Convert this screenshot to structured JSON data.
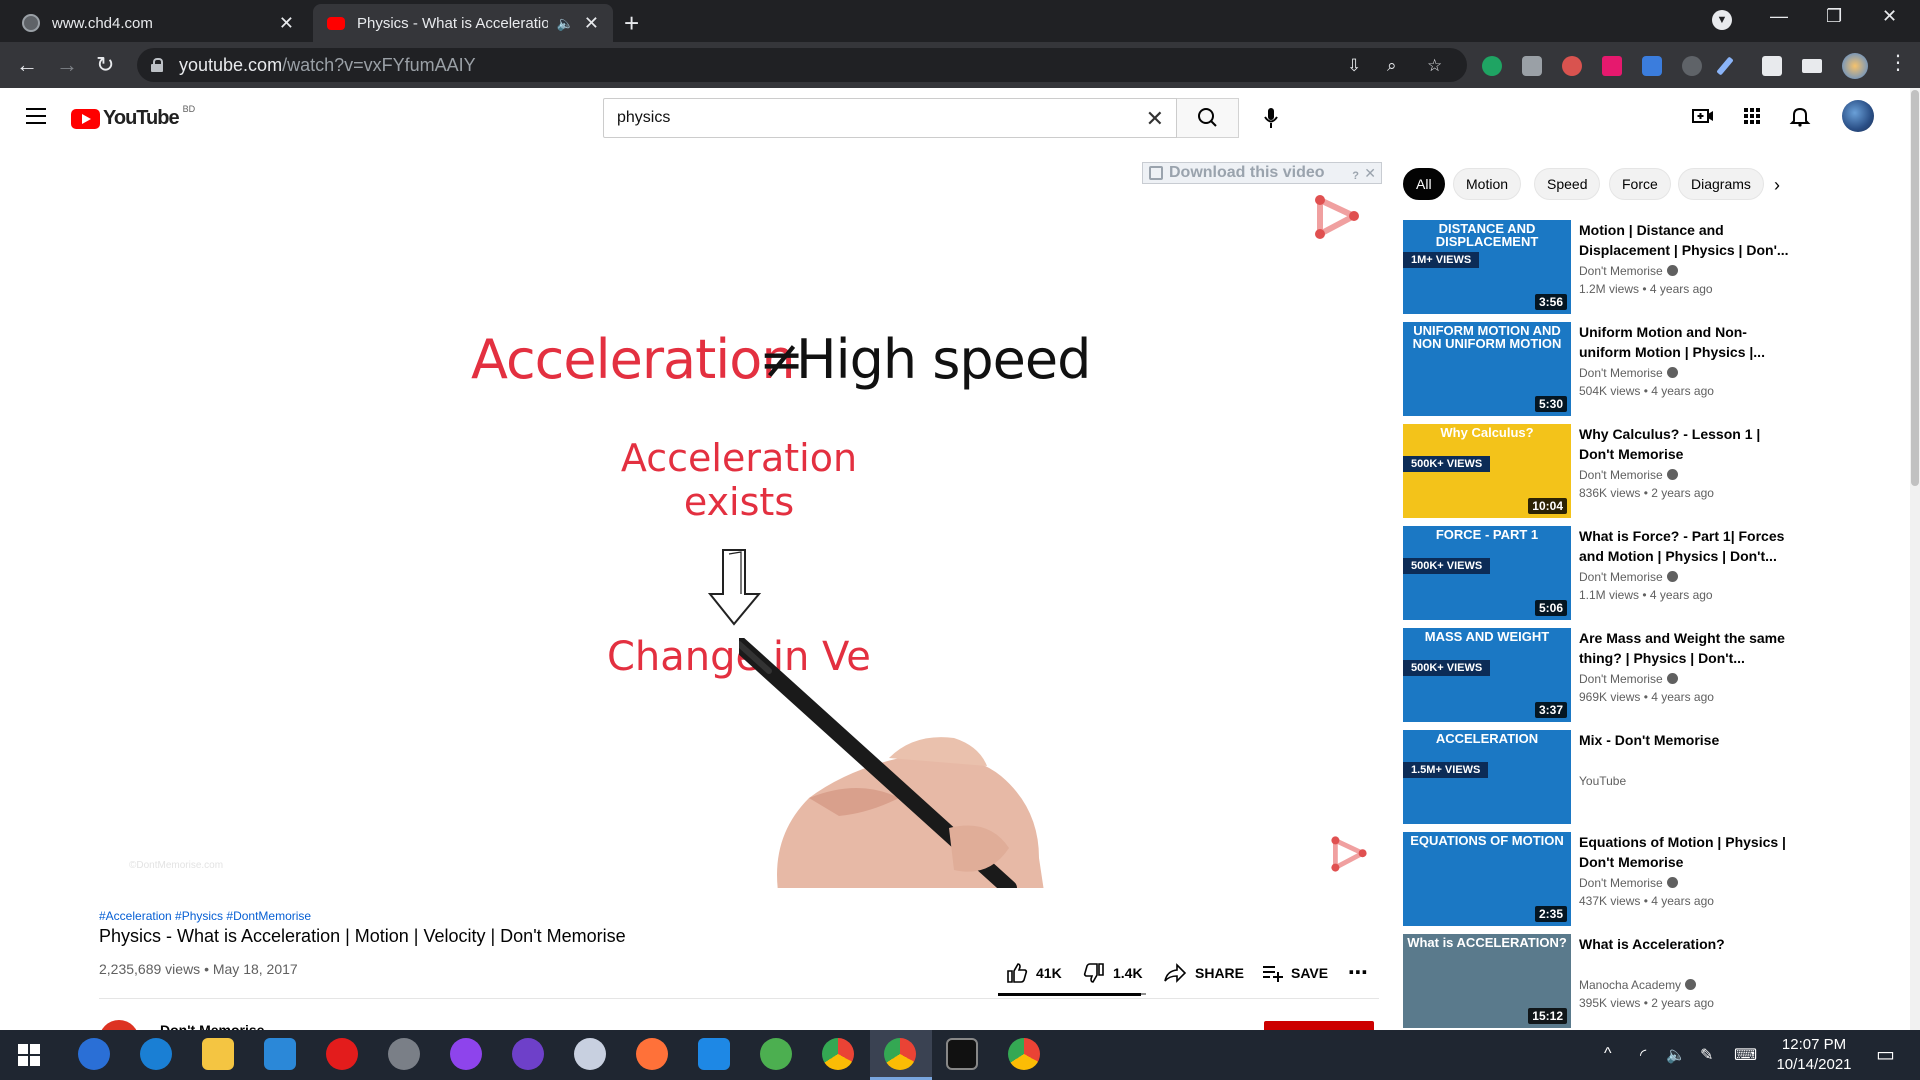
{
  "browser": {
    "tabs": [
      {
        "title": "www.chd4.com",
        "active": false
      },
      {
        "title": "Physics - What is Acceleratio",
        "active": true
      }
    ],
    "url_host": "youtube.com",
    "url_path": "/watch?v=vxFYfumAAIY"
  },
  "youtube": {
    "logo_text": "YouTube",
    "country": "BD",
    "search_query": "physics"
  },
  "player": {
    "download_banner": "Download this video",
    "download_help": "?",
    "frame_title_red": "Acceleration",
    "frame_neq": "≠",
    "frame_title_black": "High speed",
    "frame_acc_line1": "Acceleration",
    "frame_acc_line2": "exists",
    "frame_change": "Change in Ve",
    "watermark": "©DontMemorise.com"
  },
  "video": {
    "hashtags": "#Acceleration #Physics #DontMemorise",
    "title": "Physics - What is Acceleration | Motion | Velocity | Don't Memorise",
    "meta": "2,235,689 views • May 18, 2017",
    "likes": "41K",
    "dislikes": "1.4K",
    "share_label": "SHARE",
    "save_label": "SAVE",
    "like_ratio": 0.967,
    "owner_peek": "Don't Memorise"
  },
  "chips": [
    "All",
    "Motion",
    "Speed",
    "Force",
    "Diagrams"
  ],
  "recommendations": [
    {
      "thumb_text": "DISTANCE AND DISPLACEMENT",
      "badge": "1M+ VIEWS",
      "duration": "3:56",
      "title": "Motion | Distance and Displacement | Physics | Don'...",
      "channel": "Don't Memorise",
      "stats": "1.2M views • 4 years ago",
      "color": "#1b78c4"
    },
    {
      "thumb_text": "UNIFORM MOTION AND NON UNIFORM MOTION",
      "badge": "",
      "duration": "5:30",
      "title": "Uniform Motion and Non-uniform Motion | Physics |...",
      "channel": "Don't Memorise",
      "stats": "504K views • 4 years ago",
      "color": "#1b78c4"
    },
    {
      "thumb_text": "Why Calculus?",
      "badge": "500K+ VIEWS",
      "duration": "10:04",
      "title": "Why Calculus? - Lesson 1 | Don't Memorise",
      "channel": "Don't Memorise",
      "stats": "836K views • 2 years ago",
      "color": "#f3c31a"
    },
    {
      "thumb_text": "FORCE - PART 1",
      "badge": "500K+ VIEWS",
      "duration": "5:06",
      "title": "What is Force? - Part 1| Forces and Motion | Physics | Don't...",
      "channel": "Don't Memorise",
      "stats": "1.1M views • 4 years ago",
      "color": "#1b78c4"
    },
    {
      "thumb_text": "MASS AND WEIGHT",
      "badge": "500K+ VIEWS",
      "duration": "3:37",
      "title": "Are Mass and Weight the same thing? | Physics | Don't...",
      "channel": "Don't Memorise",
      "stats": "969K views • 4 years ago",
      "color": "#1b78c4"
    },
    {
      "thumb_text": "ACCELERATION",
      "badge": "1.5M+ VIEWS",
      "duration": "",
      "title": "Mix - Don't Memorise",
      "channel": "YouTube",
      "stats": "",
      "color": "#1b78c4"
    },
    {
      "thumb_text": "EQUATIONS OF MOTION",
      "badge": "",
      "duration": "2:35",
      "title": "Equations of Motion | Physics | Don't Memorise",
      "channel": "Don't Memorise",
      "stats": "437K views • 4 years ago",
      "color": "#1b78c4"
    },
    {
      "thumb_text": "What is ACCELERATION?",
      "badge": "",
      "duration": "15:12",
      "title": "What is Acceleration?",
      "channel": "Manocha Academy",
      "stats": "395K views • 2 years ago",
      "color": "#5a7a8c"
    }
  ],
  "taskbar": {
    "time": "12:07 PM",
    "date": "10/14/2021"
  }
}
